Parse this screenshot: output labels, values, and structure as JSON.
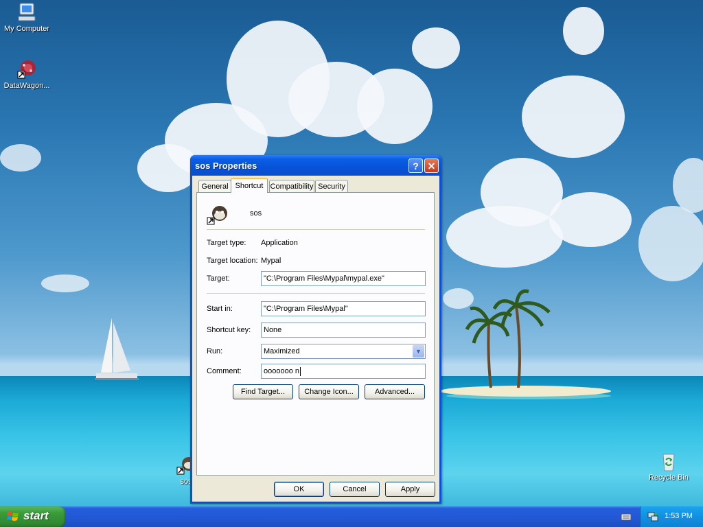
{
  "desktop": {
    "icons": [
      {
        "label": "My Computer"
      },
      {
        "label": "DataWagon..."
      },
      {
        "label": "sos"
      },
      {
        "label": "Recycle Bin"
      }
    ]
  },
  "dialog": {
    "title": "sos Properties",
    "help_button": "?",
    "close_button": "✕",
    "tabs": [
      {
        "label": "General",
        "active": false
      },
      {
        "label": "Shortcut",
        "active": true
      },
      {
        "label": "Compatibility",
        "active": false
      },
      {
        "label": "Security",
        "active": false
      }
    ],
    "shortcut_name": "sos",
    "fields": {
      "target_type_label": "Target type:",
      "target_type_value": "Application",
      "target_location_label": "Target location:",
      "target_location_value": "Mypal",
      "target_label": "Target:",
      "target_value": "\"C:\\Program Files\\Mypal\\mypal.exe\"",
      "start_in_label": "Start in:",
      "start_in_value": "\"C:\\Program Files\\Mypal\"",
      "shortcut_key_label": "Shortcut key:",
      "shortcut_key_value": "None",
      "run_label": "Run:",
      "run_value": "Maximized",
      "comment_label": "Comment:",
      "comment_value": "ooooooo n"
    },
    "buttons": {
      "find_target": "Find Target...",
      "change_icon": "Change Icon...",
      "advanced": "Advanced...",
      "ok": "OK",
      "cancel": "Cancel",
      "apply": "Apply"
    }
  },
  "taskbar": {
    "start_label": "start",
    "clock": "1:53 PM"
  },
  "colors": {
    "title_bar": "#0a5fe6",
    "start_button": "#3a9d3a",
    "tray": "#1290e0",
    "dialog_face": "#ece9d8"
  }
}
